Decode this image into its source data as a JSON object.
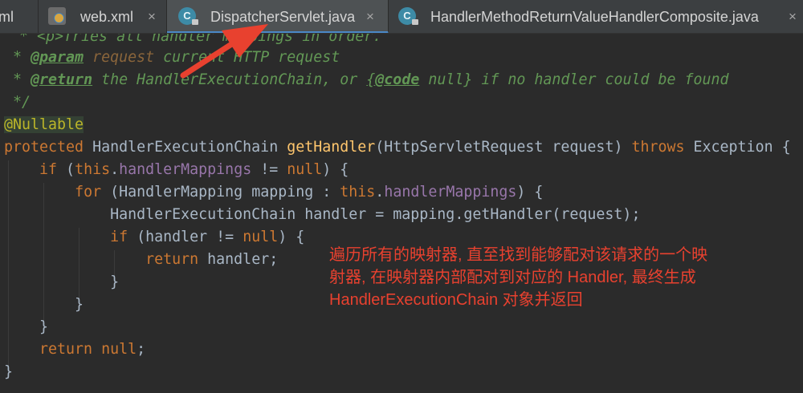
{
  "tabs": [
    {
      "label": "ml",
      "icon": "xml-file-icon",
      "closable": false,
      "active": false
    },
    {
      "label": "web.xml",
      "icon": "xml-file-icon",
      "closable": true,
      "active": false
    },
    {
      "label": "DispatcherServlet.java",
      "icon": "java-class-icon",
      "closable": true,
      "active": true
    },
    {
      "label": "HandlerMethodReturnValueHandlerComposite.java",
      "icon": "java-class-icon",
      "closable": true,
      "active": false
    }
  ],
  "close_glyph": "×",
  "class_glyph": "C",
  "code": {
    "doc_line_partial": "* <p>Tries all handler mappings in order.",
    "param_prefix": " * ",
    "param_tag": "@param",
    "param_name": " request",
    "param_desc": " current HTTP request",
    "return_prefix": " * ",
    "return_tag": "@return",
    "return_desc_1": " the HandlerExecutionChain, or ",
    "return_code_open": "{",
    "return_code_tag": "@code",
    "return_code_rest": " null}",
    "return_desc_2": " if no handler could be found",
    "doc_end": " */",
    "annotation": "@Nullable",
    "sig_kw": "protected",
    "sig_type": " HandlerExecutionChain ",
    "sig_method": "getHandler",
    "sig_params": "(HttpServletRequest request) ",
    "sig_throws": "throws",
    "sig_exc": " Exception {",
    "if1_indent": "    ",
    "if1_kw": "if",
    "if1_open": " (",
    "if1_this": "this",
    "if1_dot": ".",
    "if1_field": "handlerMappings",
    "if1_op": " != ",
    "if1_null": "null",
    "if1_close": ") {",
    "for_indent": "        ",
    "for_kw": "for",
    "for_mid": " (HandlerMapping mapping : ",
    "for_this": "this",
    "for_dot": ".",
    "for_field": "handlerMappings",
    "for_close": ") {",
    "assign_line": "            HandlerExecutionChain handler = mapping.getHandler(request);",
    "if2_indent": "            ",
    "if2_kw": "if",
    "if2_mid": " (handler != ",
    "if2_null": "null",
    "if2_close": ") {",
    "ret1_indent": "                ",
    "ret1_kw": "return",
    "ret1_rest": " handler;",
    "brace_12": "            }",
    "brace_8": "        }",
    "brace_4": "    }",
    "ret2_indent": "    ",
    "ret2_kw": "return",
    "ret2_sp": " ",
    "ret2_null": "null",
    "ret2_semi": ";",
    "brace_0": "}"
  },
  "annotation_note": {
    "line1": "遍历所有的映射器, 直至找到能够配对该请求的一个映",
    "line2": "射器, 在映射器内部配对到对应的 Handler, 最终生成",
    "line3": "HandlerExecutionChain 对象并返回",
    "color": "#e8412f"
  },
  "colors": {
    "background": "#2b2b2b",
    "keyword": "#cc7832",
    "field": "#9876aa",
    "method": "#ffc66d",
    "annotation": "#bbb529",
    "doc_comment": "#629755",
    "default_text": "#a9b7c6",
    "active_tab_underline": "#4a88c7",
    "arrow": "#e8412f"
  }
}
